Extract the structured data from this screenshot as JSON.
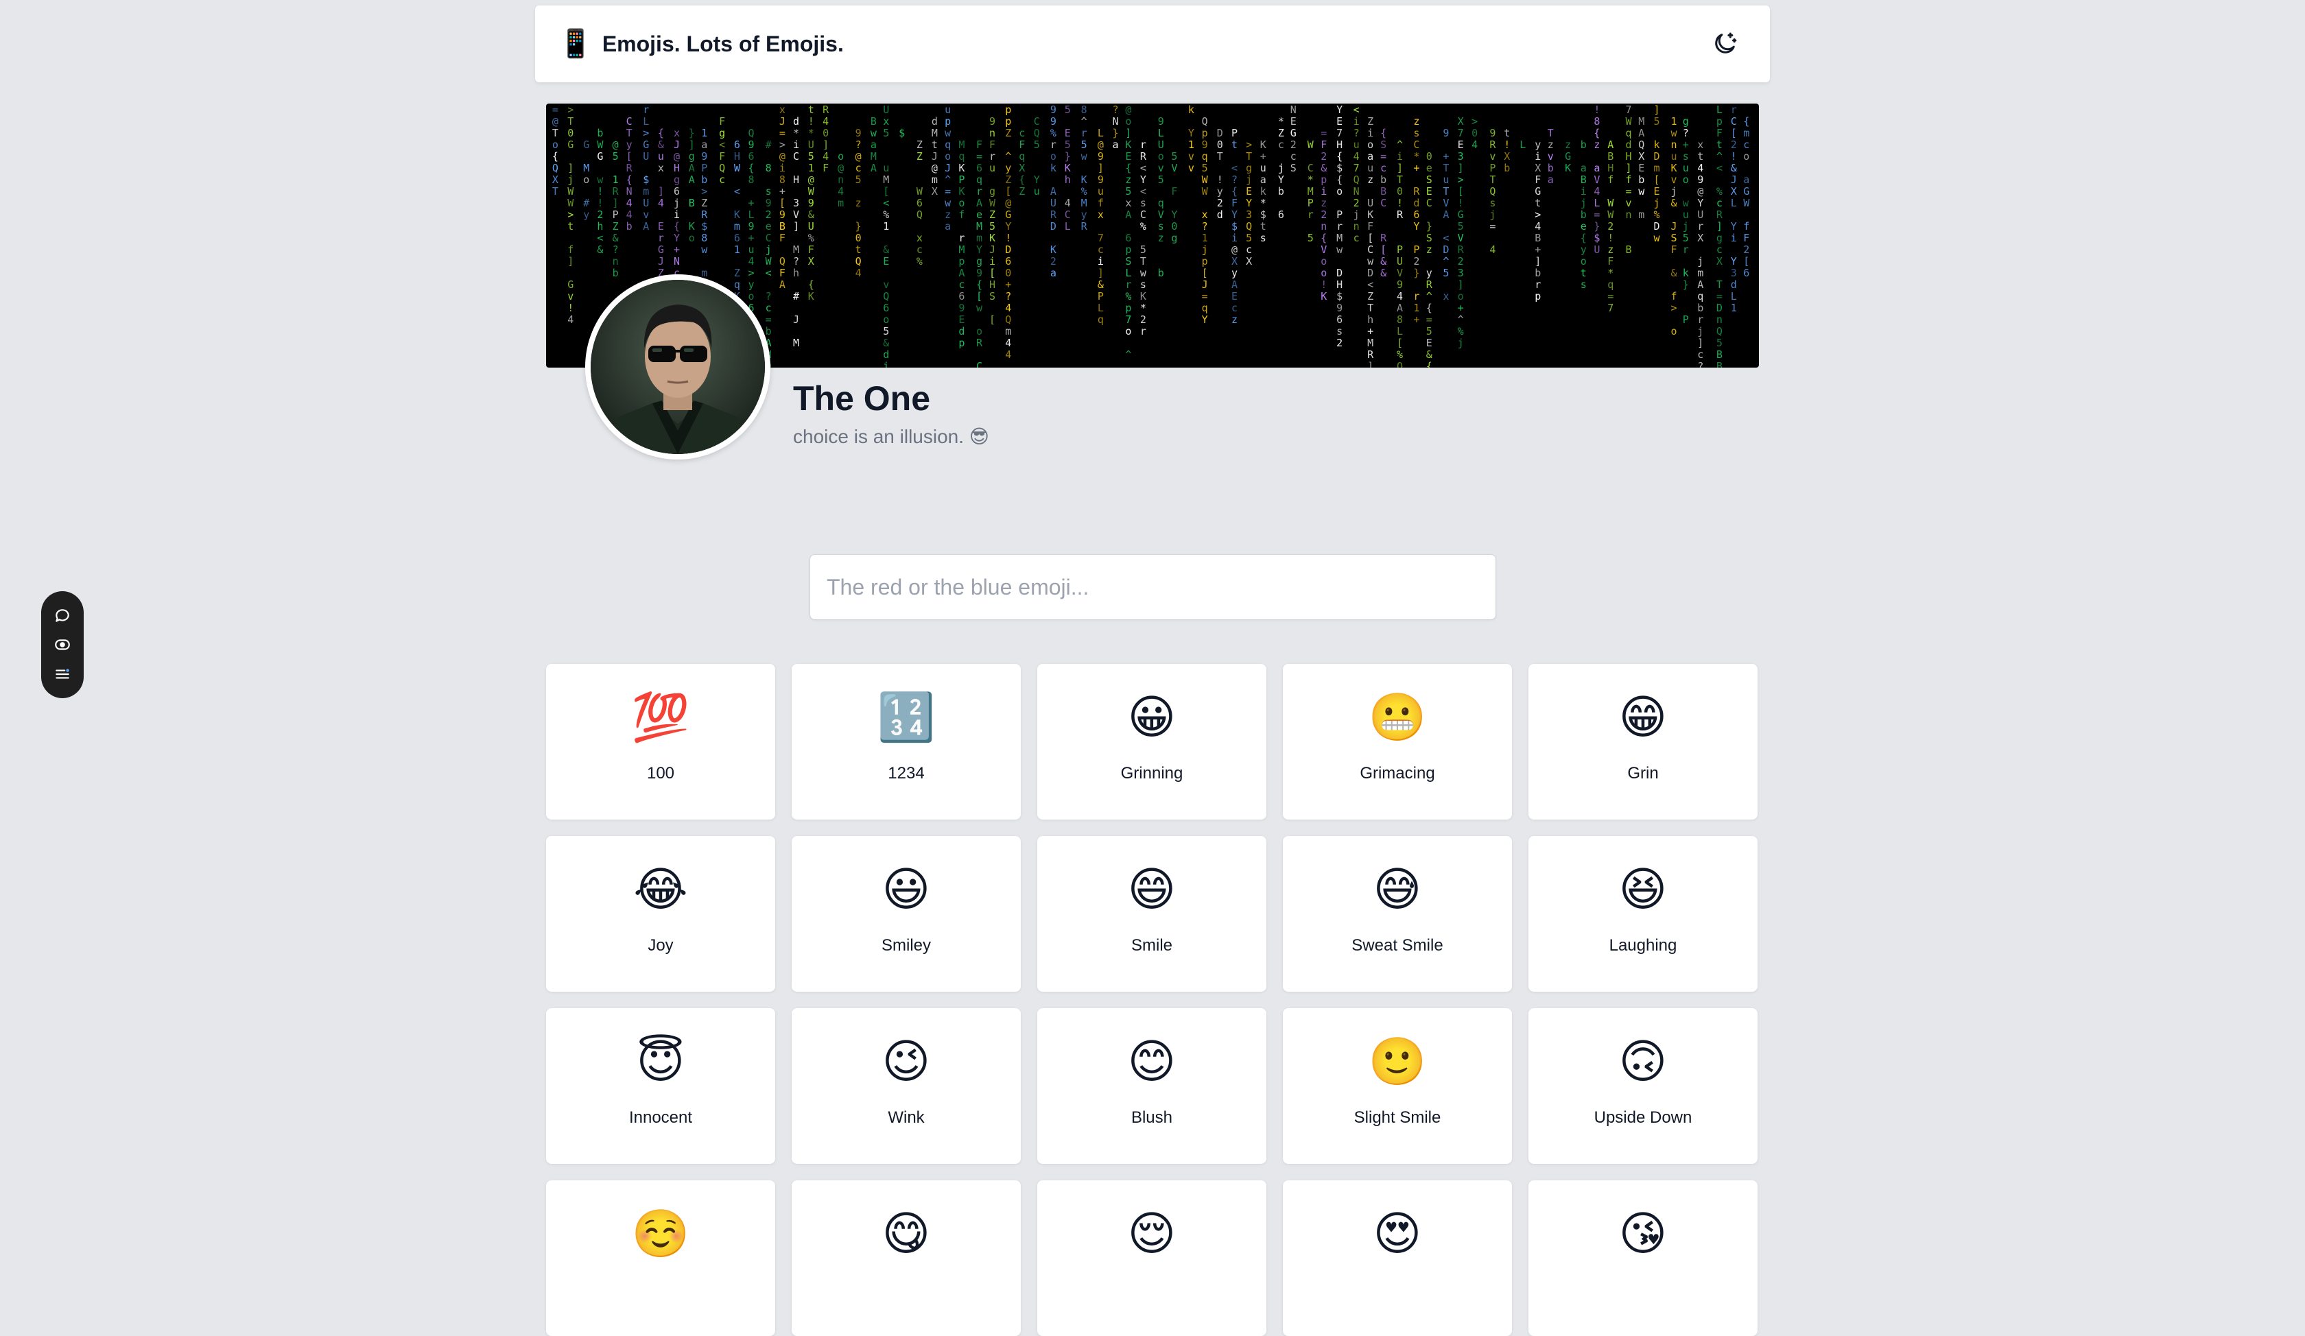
{
  "header": {
    "icon": "📱",
    "title": "Emojis. Lots of Emojis.",
    "theme_toggle_icon": "moon-sparkle-icon"
  },
  "banner": {
    "style": "matrix-code-rain",
    "colors": [
      "#22c55e",
      "#a3e635",
      "#c084fc",
      "#60a5fa",
      "#f9fafb",
      "#facc15"
    ]
  },
  "profile": {
    "name": "The One",
    "bio": "choice is an illusion. 😎"
  },
  "search": {
    "placeholder": "The red or the blue emoji...",
    "value": ""
  },
  "emojis": [
    {
      "char": "💯",
      "label": "100"
    },
    {
      "char": "🔢",
      "label": "1234"
    },
    {
      "char": "😀",
      "label": "Grinning"
    },
    {
      "char": "😬",
      "label": "Grimacing"
    },
    {
      "char": "😁",
      "label": "Grin"
    },
    {
      "char": "😂",
      "label": "Joy"
    },
    {
      "char": "😃",
      "label": "Smiley"
    },
    {
      "char": "😄",
      "label": "Smile"
    },
    {
      "char": "😅",
      "label": "Sweat Smile"
    },
    {
      "char": "😆",
      "label": "Laughing"
    },
    {
      "char": "😇",
      "label": "Innocent"
    },
    {
      "char": "😉",
      "label": "Wink"
    },
    {
      "char": "😊",
      "label": "Blush"
    },
    {
      "char": "🙂",
      "label": "Slight Smile"
    },
    {
      "char": "🙃",
      "label": "Upside Down"
    },
    {
      "char": "☺️",
      "label": ""
    },
    {
      "char": "😋",
      "label": ""
    },
    {
      "char": "😌",
      "label": ""
    },
    {
      "char": "😍",
      "label": ""
    },
    {
      "char": "😘",
      "label": ""
    }
  ],
  "dock": {
    "items": [
      "chat-bubble-icon",
      "eye-toggle-icon",
      "menu-list-icon"
    ]
  }
}
